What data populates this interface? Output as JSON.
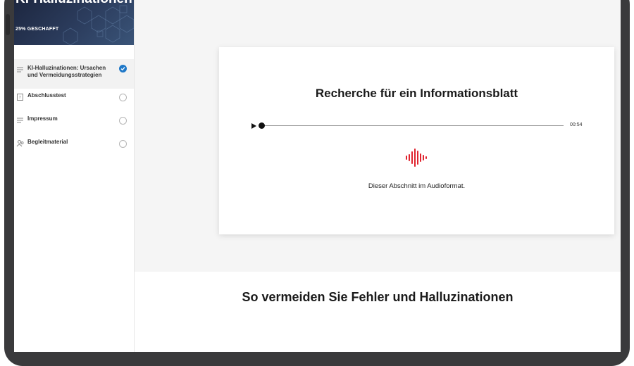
{
  "sidebar": {
    "course_title": "KI-Halluzinationen",
    "progress_text": "25% GESCHAFFT",
    "progress_percent": 25,
    "items": [
      {
        "label": "KI-Halluzinationen: Ursachen und Vermeidungsstrategien",
        "icon": "lines-icon",
        "completed": true
      },
      {
        "label": "Abschlusstest",
        "icon": "quiz-icon",
        "completed": false
      },
      {
        "label": "Impressum",
        "icon": "lines-icon",
        "completed": false
      },
      {
        "label": "Begleitmaterial",
        "icon": "people-icon",
        "completed": false
      }
    ]
  },
  "audio_card": {
    "title": "Recherche für ein Informationsblatt",
    "duration": "00:54",
    "caption": "Dieser Abschnitt im Audioformat.",
    "accent_color": "#e0242f"
  },
  "next_section": {
    "heading": "So vermeiden Sie Fehler und Halluzinationen"
  },
  "colors": {
    "check_blue": "#1f78c8",
    "hero_dark": "#1d2740"
  }
}
